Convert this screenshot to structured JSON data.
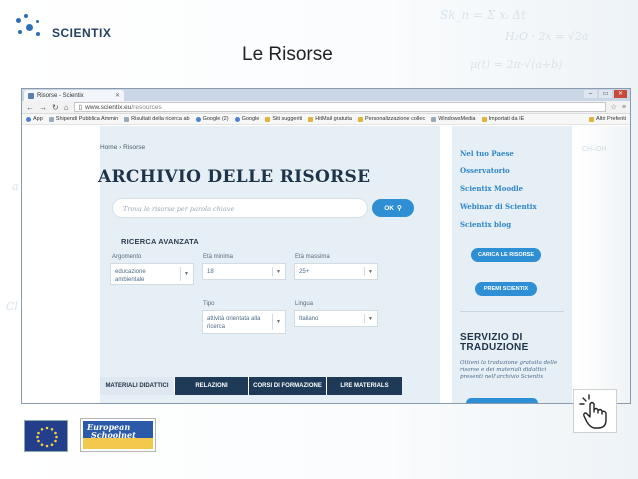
{
  "slide": {
    "title": "Le  Risorse",
    "logo_text": "SCIENTIX"
  },
  "browser": {
    "tab_title": "Risorse - Scientix",
    "url_prefix": "www.scientix.eu",
    "url_path": "/resources",
    "bookmarks": [
      "App",
      "Shipendi Pubblica Ammin",
      "Risultati della ricerca ab",
      "Google (2)",
      "Google",
      "Siti suggeriti",
      "HitMail gratuita",
      "Personalizzazione collec",
      "WindowsMedia",
      "Importati da IE"
    ],
    "bookmark_right": "Altri Preferiti"
  },
  "page": {
    "breadcrumb": "Home › Risorse",
    "heading": "ARCHIVIO DELLE RISORSE",
    "search_placeholder": "Trova le risorse per parola chiave",
    "search_button": "OK",
    "advanced_title": "RICERCA AVANZATA",
    "filters": {
      "argomento_label": "Argomento",
      "argomento_value": "educazione ambientale",
      "eta_min_label": "Età minima",
      "eta_min_value": "18",
      "eta_max_label": "Età massima",
      "eta_max_value": "25+",
      "tipo_label": "Tipo",
      "tipo_value": "attività orientata alla ricerca",
      "lingua_label": "Lingua",
      "lingua_value": "Italiano"
    },
    "tabs": [
      "MATERIALI DIDATTICI",
      "RELAZIONI",
      "CORSI DI FORMAZIONE",
      "LRE MATERIALS"
    ]
  },
  "sidebar": {
    "links": [
      "Nel tuo Paese",
      "Osservatorio",
      "Scientix Moodle",
      "Webinar di Scientix",
      "Scientix blog"
    ],
    "button_upload": "CARICA LE RISORSE",
    "button_prizes": "PREMI SCIENTIX",
    "service_title_1": "SERVIZIO DI",
    "service_title_2": "TRADUZIONE",
    "service_text": "Ottieni la traduzione gratuita delle risorse e dei materiali didattici presenti nell'archivio Scientix"
  },
  "footer": {
    "esn_line1": "European",
    "esn_line2": "Schoolnet"
  },
  "colors": {
    "accent_blue": "#2f8fd4",
    "navy": "#1e3a56",
    "panel_bg": "#e6eff6"
  }
}
